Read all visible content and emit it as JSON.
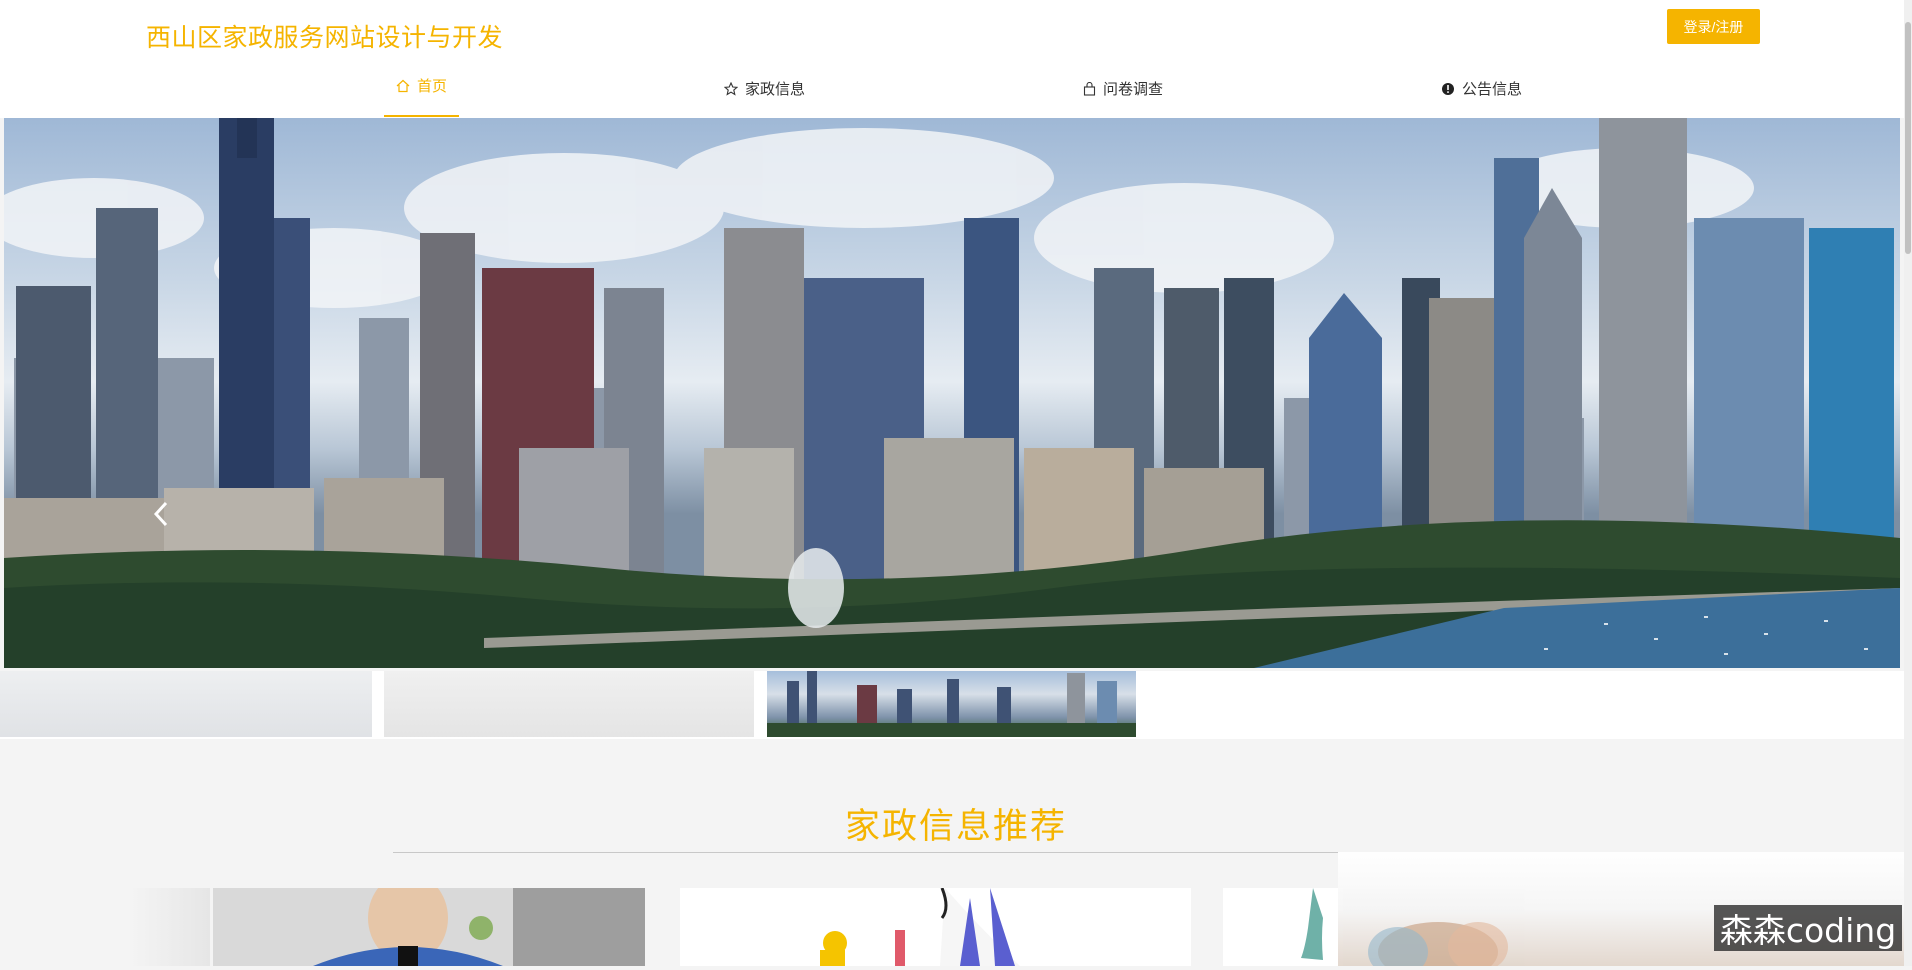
{
  "header": {
    "site_title": "西山区家政服务网站设计与开发",
    "login_label": "登录/注册"
  },
  "nav": {
    "items": [
      {
        "label": "首页",
        "icon": "home-icon"
      },
      {
        "label": "家政信息",
        "icon": "star-icon"
      },
      {
        "label": "问卷调查",
        "icon": "bag-icon"
      },
      {
        "label": "公告信息",
        "icon": "info-icon"
      }
    ]
  },
  "section": {
    "title": "家政信息推荐"
  },
  "watermark": "森森coding",
  "colors": {
    "accent": "#f5b400",
    "text": "#333333",
    "background": "#f4f4f4"
  }
}
